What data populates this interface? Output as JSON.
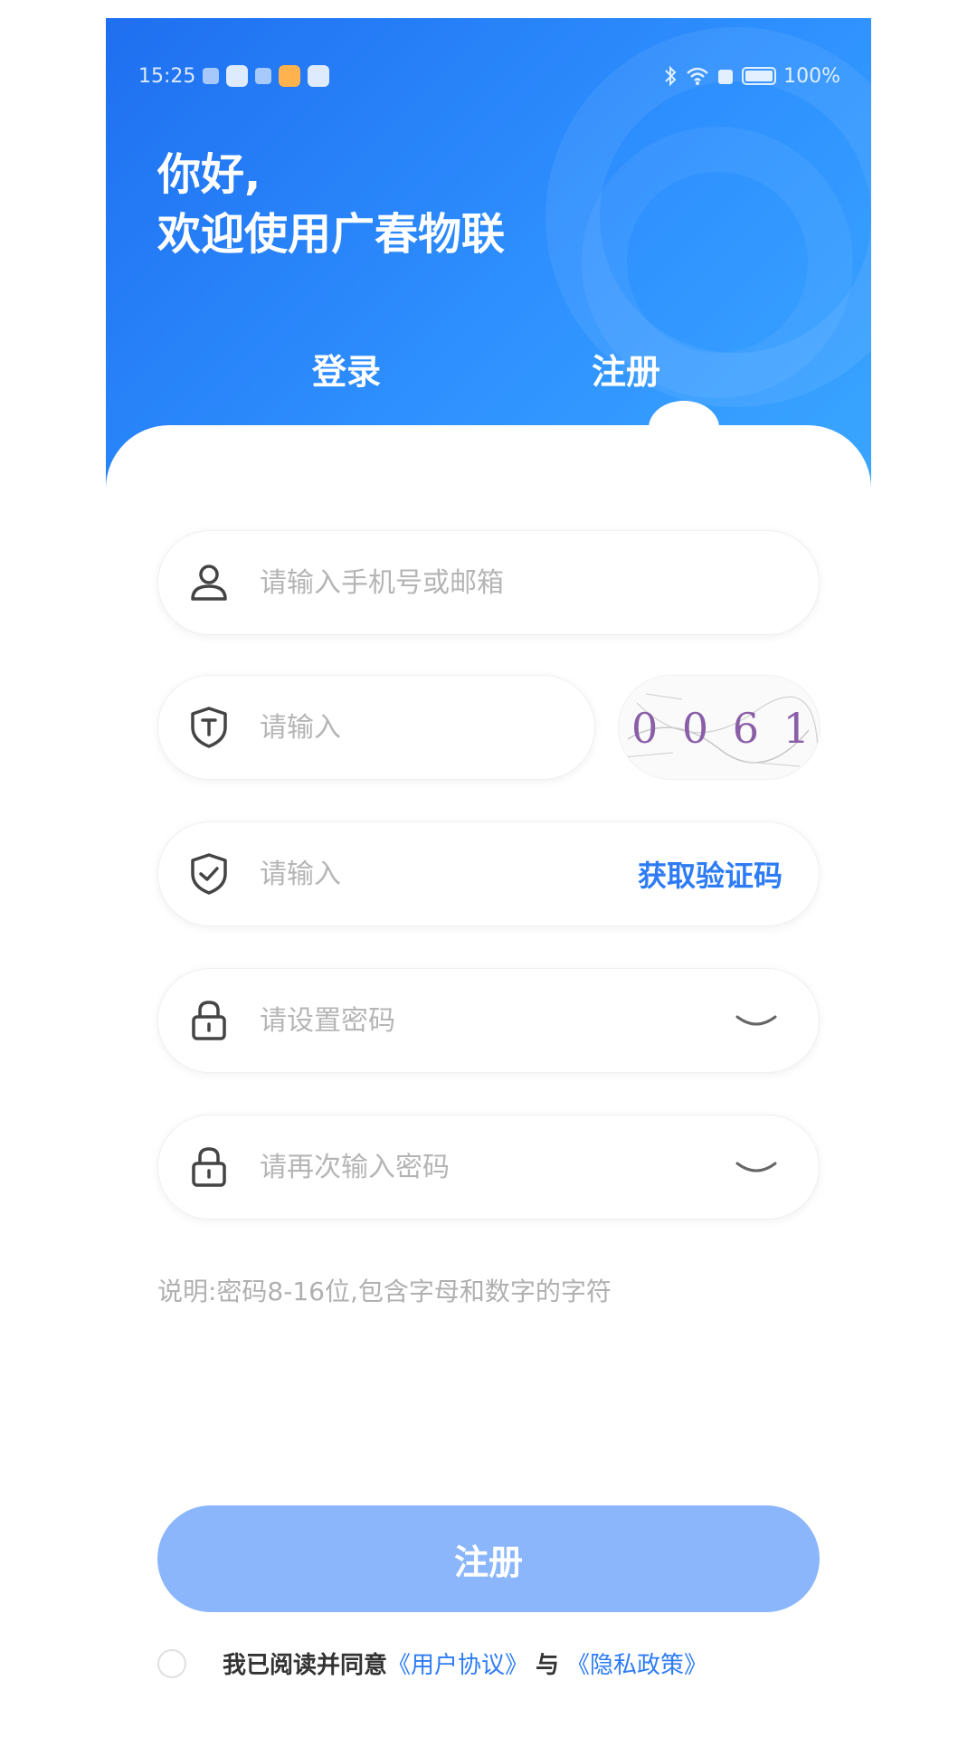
{
  "status_bar": {
    "time": "15:25",
    "battery": "100%"
  },
  "header": {
    "greeting_line1": "你好,",
    "greeting_line2": "欢迎使用广春物联",
    "tabs": [
      {
        "label": "登录",
        "active": false
      },
      {
        "label": "注册",
        "active": true
      }
    ]
  },
  "form": {
    "account": {
      "placeholder": "请输入手机号或邮箱",
      "value": ""
    },
    "captcha_input": {
      "placeholder": "请输入",
      "value": ""
    },
    "captcha_image_text": "0 0 6 1",
    "sms_code": {
      "placeholder": "请输入",
      "value": "",
      "action_label": "获取验证码"
    },
    "password": {
      "placeholder": "请设置密码",
      "value": ""
    },
    "confirm_password": {
      "placeholder": "请再次输入密码",
      "value": ""
    },
    "hint": "说明:密码8-16位,包含字母和数字的字符",
    "submit_label": "注册"
  },
  "agreement": {
    "prefix": "我已阅读并同意",
    "user_agreement": "《用户协议》",
    "and": "与",
    "privacy_policy": "《隐私政策》",
    "checked": false
  },
  "colors": {
    "brand_blue": "#2d7cf6",
    "header_gradient_start": "#1f6ff0",
    "header_gradient_end": "#3aa6ff",
    "submit_disabled": "#8bb6fb",
    "placeholder": "#b5b5b5"
  }
}
